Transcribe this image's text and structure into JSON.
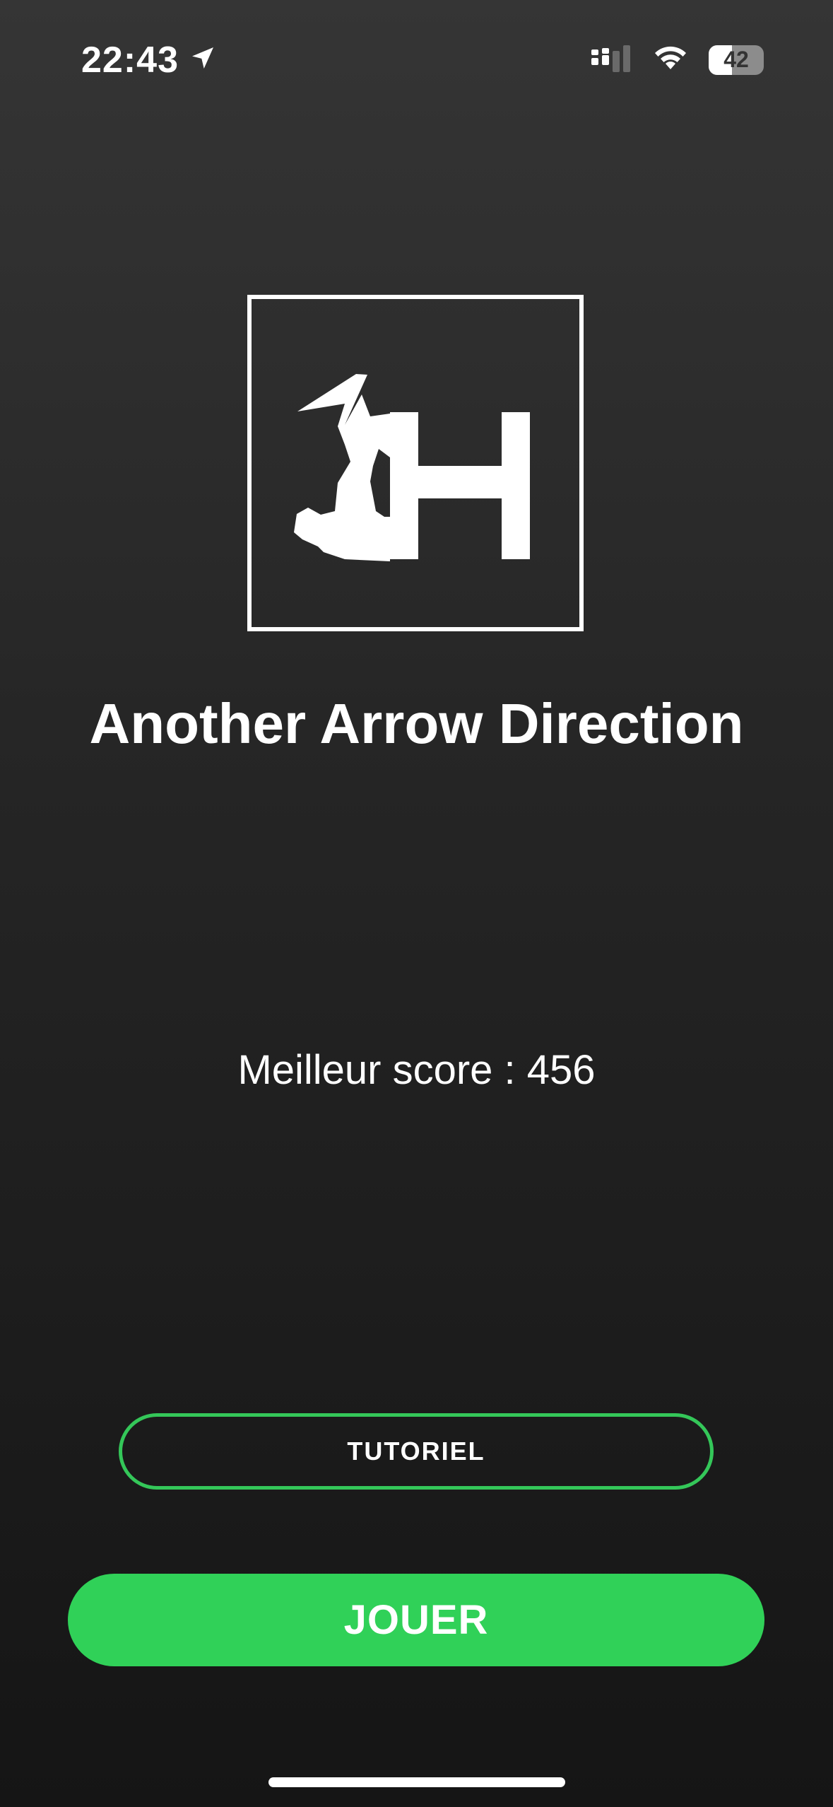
{
  "status_bar": {
    "time": "22:43",
    "battery_level": "42",
    "battery_fraction": 0.42
  },
  "app": {
    "title": "Another Arrow Direction",
    "best_score_text": "Meilleur score : 456"
  },
  "buttons": {
    "tutorial_label": "TUTORIEL",
    "play_label": "JOUER"
  },
  "colors": {
    "accent_green": "#30d158",
    "tutorial_border": "#34c759",
    "background_top": "#353535",
    "background_bottom": "#151515"
  },
  "icons": {
    "location": "location-arrow-icon",
    "signal": "cellular-signal-icon",
    "wifi": "wifi-icon",
    "battery": "battery-icon",
    "logo": "app-logo-icon"
  }
}
